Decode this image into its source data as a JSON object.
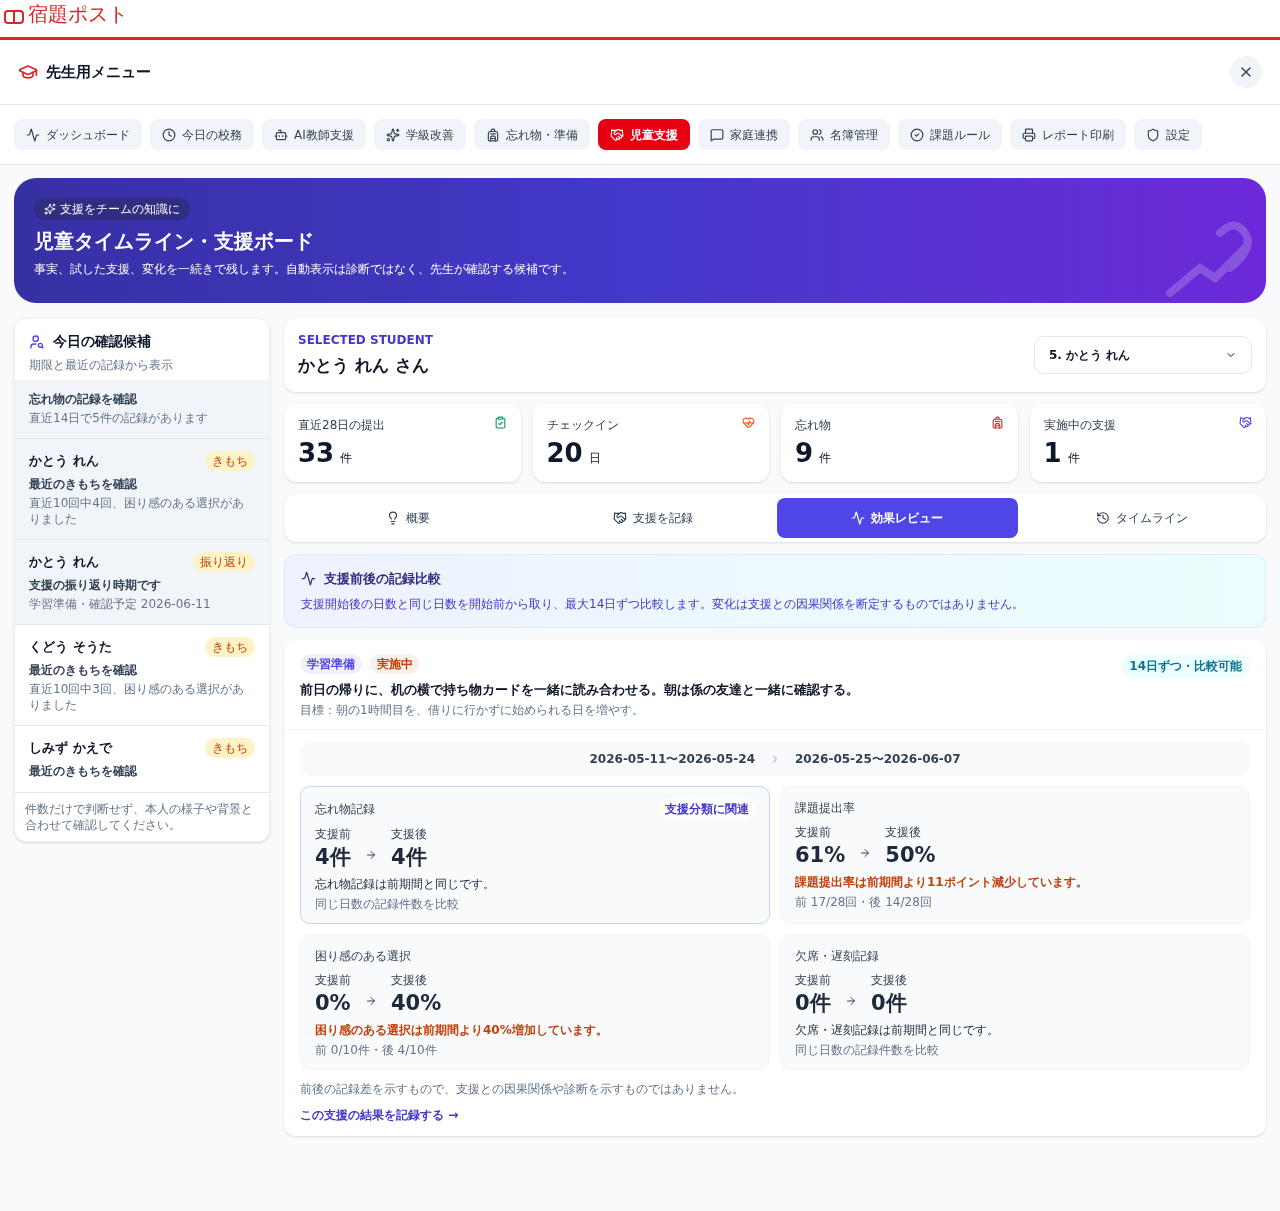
{
  "app": {
    "logo": "宿題ポスト"
  },
  "menu": {
    "title": "先生用メニュー"
  },
  "nav": [
    {
      "label": "ダッシュボード",
      "selected": false
    },
    {
      "label": "今日の校務",
      "selected": false
    },
    {
      "label": "AI教師支援",
      "selected": false
    },
    {
      "label": "学級改善",
      "selected": false
    },
    {
      "label": "忘れ物・準備",
      "selected": false
    },
    {
      "label": "児童支援",
      "selected": true
    },
    {
      "label": "家庭連携",
      "selected": false
    },
    {
      "label": "名簿管理",
      "selected": false
    },
    {
      "label": "課題ルール",
      "selected": false
    },
    {
      "label": "レポート印刷",
      "selected": false
    },
    {
      "label": "設定",
      "selected": false
    }
  ],
  "banner": {
    "tag": "支援をチームの知識に",
    "title": "児童タイムライン・支援ボード",
    "subtitle": "事実、試した支援、変化を一続きで残します。自動表示は診断ではなく、先生が確認する候補です。"
  },
  "candidates": {
    "title": "今日の確認候補",
    "subtitle": "期限と最近の記録から表示",
    "items": [
      {
        "title": "忘れ物の記録を確認",
        "detail": "直近14日で5件の記録があります",
        "selected": true
      },
      {
        "name": "かとう れん",
        "badge": "きもち",
        "title": "最近のきもちを確認",
        "detail": "直近10回中4回、困り感のある選択がありました",
        "selected": true
      },
      {
        "name": "かとう れん",
        "badge": "振り返り",
        "title": "支援の振り返り時期です",
        "detail": "学習準備・確認予定 2026-06-11",
        "selected": true
      },
      {
        "name": "くどう そうた",
        "badge": "きもち",
        "title": "最近のきもちを確認",
        "detail": "直近10回中3回、困り感のある選択がありました",
        "selected": false
      },
      {
        "name": "しみず かえで",
        "badge": "きもち",
        "title": "最近のきもちを確認",
        "selected": false
      }
    ],
    "note": "件数だけで判断せず、本人の様子や背景と合わせて確認してください。"
  },
  "student": {
    "caption": "SELECTED STUDENT",
    "name": "かとう れん さん",
    "select_value": "5. かとう れん"
  },
  "metrics": [
    {
      "label": "直近28日の提出",
      "value": "33",
      "unit": "件"
    },
    {
      "label": "チェックイン",
      "value": "20",
      "unit": "日"
    },
    {
      "label": "忘れ物",
      "value": "9",
      "unit": "件"
    },
    {
      "label": "実施中の支援",
      "value": "1",
      "unit": "件"
    }
  ],
  "tabs": [
    {
      "label": "概要",
      "selected": false
    },
    {
      "label": "支援を記録",
      "selected": false
    },
    {
      "label": "効果レビュー",
      "selected": true
    },
    {
      "label": "タイムライン",
      "selected": false
    }
  ],
  "info": {
    "title": "支援前後の記録比較",
    "text": "支援開始後の日数と同じ日数を開始前から取り、最大14日ずつ比較します。変化は支援との因果関係を断定するものではありません。"
  },
  "plan": {
    "tags": [
      {
        "label": "学習準備",
        "color": "#4f46e5"
      },
      {
        "label": "実施中",
        "color": "#c2410c"
      }
    ],
    "badge": "14日ずつ・比較可能",
    "title": "前日の帰りに、机の横で持ち物カードを一緒に読み合わせる。朝は係の友達と一緒に確認する。",
    "goal": "目標：朝の1時間目を、借りに行かずに始められる日を増やす。",
    "period_before": "2026-05-11〜2026-05-24",
    "period_after": "2026-05-25〜2026-06-07",
    "cards": [
      {
        "title": "忘れ物記録",
        "related": "支援分類に関連",
        "before_label": "支援前",
        "before": "4件",
        "after_label": "支援後",
        "after": "4件",
        "message": "忘れ物記録は前期間と同じです。",
        "warning": false,
        "detail": "同じ日数の記録件数を比較"
      },
      {
        "title": "課題提出率",
        "before_label": "支援前",
        "before": "61%",
        "after_label": "支援後",
        "after": "50%",
        "message": "課題提出率は前期間より11ポイント減少しています。",
        "warning": true,
        "detail": "前 17/28回・後 14/28回"
      },
      {
        "title": "困り感のある選択",
        "before_label": "支援前",
        "before": "0%",
        "after_label": "支援後",
        "after": "40%",
        "message": "困り感のある選択は前期間より40%増加しています。",
        "warning": true,
        "detail": "前 0/10件・後 4/10件"
      },
      {
        "title": "欠席・遅刻記録",
        "before_label": "支援前",
        "before": "0件",
        "after_label": "支援後",
        "after": "0件",
        "message": "欠席・遅刻記録は前期間と同じです。",
        "warning": false,
        "detail": "同じ日数の記録件数を比較"
      }
    ],
    "note": "前後の記録差を示すもので、支援との因果関係や診断を示すものではありません。",
    "link": "この支援の結果を記録する →"
  }
}
